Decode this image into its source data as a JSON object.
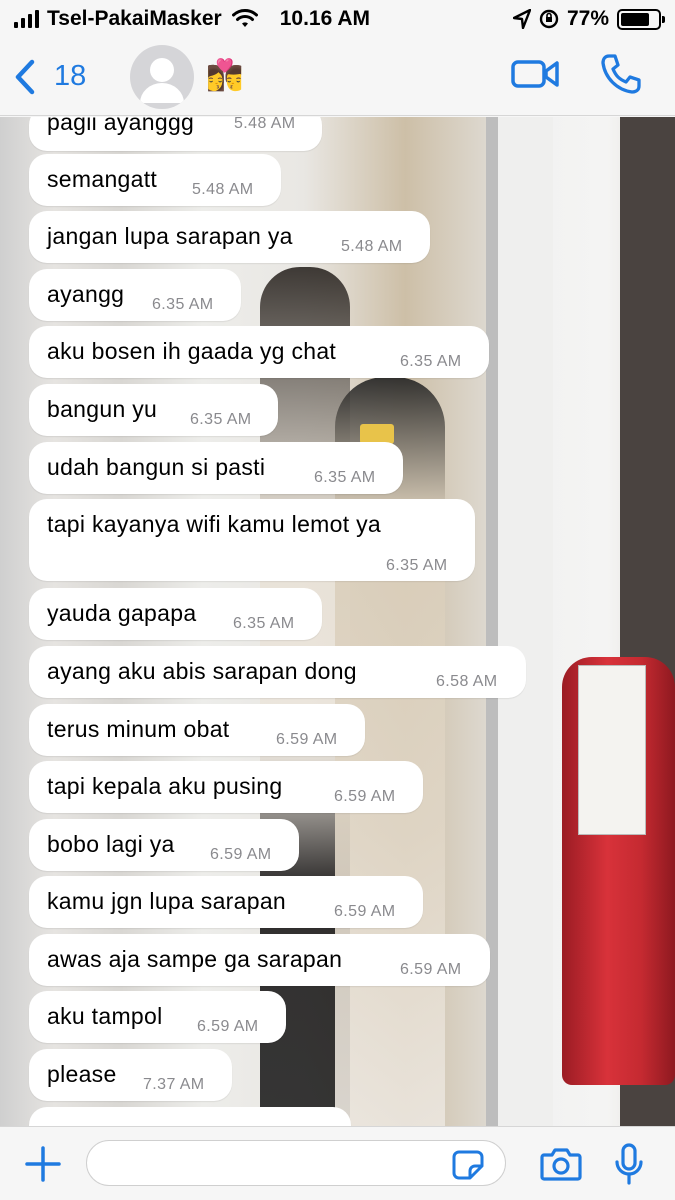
{
  "status_bar": {
    "carrier": "Tsel-PakaiMasker",
    "time": "10.16 AM",
    "battery_text": "77%",
    "battery_level": 0.77
  },
  "header": {
    "back_count": "18",
    "contact_emoji": "👩‍❤️‍💋‍👨",
    "accent_color": "#1f7ae0"
  },
  "messages": [
    {
      "text": "pagii ayanggg",
      "time": "5.48 AM"
    },
    {
      "text": "semangatt",
      "time": "5.48 AM"
    },
    {
      "text": "jangan lupa sarapan ya",
      "time": "5.48 AM"
    },
    {
      "text": "ayangg",
      "time": "6.35 AM"
    },
    {
      "text": "aku bosen ih gaada yg chat",
      "time": "6.35 AM"
    },
    {
      "text": "bangun yu",
      "time": "6.35 AM"
    },
    {
      "text": "udah bangun si pasti",
      "time": "6.35 AM"
    },
    {
      "text": "tapi kayanya wifi kamu lemot ya",
      "time": "6.35 AM"
    },
    {
      "text": "yauda gapapa",
      "time": "6.35 AM"
    },
    {
      "text": "ayang aku abis sarapan dong",
      "time": "6.58 AM"
    },
    {
      "text": "terus minum obat",
      "time": "6.59 AM"
    },
    {
      "text": "tapi kepala aku pusing",
      "time": "6.59 AM"
    },
    {
      "text": "bobo lagi ya",
      "time": "6.59 AM"
    },
    {
      "text": "kamu jgn lupa sarapan",
      "time": "6.59 AM"
    },
    {
      "text": "awas aja sampe ga sarapan",
      "time": "6.59 AM"
    },
    {
      "text": "aku tampol",
      "time": "6.59 AM"
    },
    {
      "text": "please",
      "time": "7.37 AM"
    }
  ],
  "composer": {
    "placeholder": ""
  },
  "icons": {
    "back": "chevron-left-icon",
    "video": "video-camera-icon",
    "call": "phone-icon",
    "plus": "plus-icon",
    "sticker": "sticker-icon",
    "camera": "camera-icon",
    "mic": "microphone-icon"
  }
}
